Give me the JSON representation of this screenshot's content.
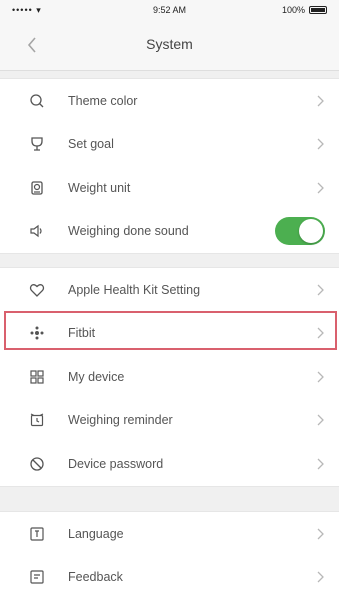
{
  "status_bar": {
    "carrier": "••••• ▾",
    "time": "9:52 AM",
    "battery": "100%"
  },
  "nav": {
    "back_icon": "chevron-left-icon",
    "title": "System"
  },
  "groups": [
    {
      "items": [
        {
          "label": "Theme color",
          "icon": "theme-color-icon",
          "control": "chevron"
        },
        {
          "label": "Set goal",
          "icon": "trophy-icon",
          "control": "chevron"
        },
        {
          "label": "Weight unit",
          "icon": "scale-icon",
          "control": "chevron"
        },
        {
          "label": "Weighing done sound",
          "icon": "speaker-icon",
          "control": "toggle",
          "toggle_on": true
        }
      ]
    },
    {
      "items": [
        {
          "label": "Apple Health Kit Setting",
          "icon": "heart-icon",
          "control": "chevron"
        },
        {
          "label": "Fitbit",
          "icon": "fitbit-icon",
          "control": "chevron",
          "highlighted": true
        },
        {
          "label": "My device",
          "icon": "device-icon",
          "control": "chevron"
        },
        {
          "label": "Weighing reminder",
          "icon": "alarm-clock-icon",
          "control": "chevron"
        },
        {
          "label": "Device password",
          "icon": "lock-icon",
          "control": "chevron"
        }
      ]
    },
    {
      "items": [
        {
          "label": "Language",
          "icon": "language-icon",
          "control": "chevron"
        },
        {
          "label": "Feedback",
          "icon": "feedback-icon",
          "control": "chevron"
        }
      ]
    }
  ],
  "colors": {
    "accent_toggle": "#4caf50",
    "highlight_border": "#d9606d",
    "background": "#f0f0f0"
  }
}
